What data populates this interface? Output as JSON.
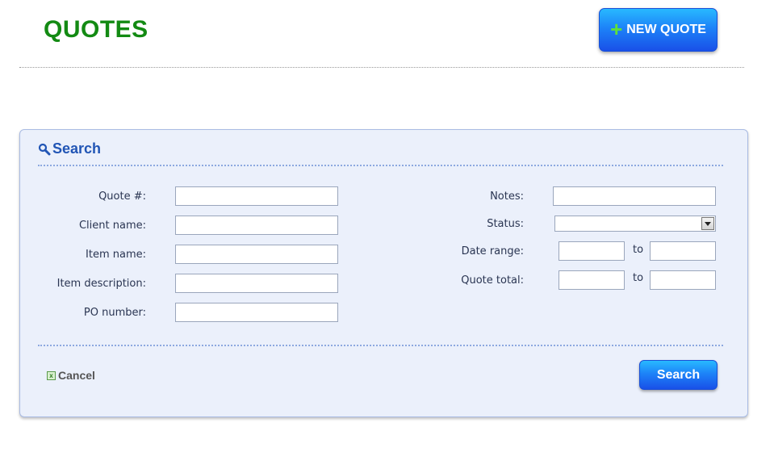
{
  "header": {
    "title": "QUOTES",
    "new_button_label": "NEW QUOTE"
  },
  "search_panel": {
    "title": "Search",
    "left_fields": [
      {
        "label": "Quote #:",
        "value": ""
      },
      {
        "label": "Client name:",
        "value": ""
      },
      {
        "label": "Item name:",
        "value": ""
      },
      {
        "label": "Item description:",
        "value": ""
      },
      {
        "label": "PO number:",
        "value": ""
      }
    ],
    "notes": {
      "label": "Notes:",
      "value": ""
    },
    "status": {
      "label": "Status:",
      "selected": ""
    },
    "date_range": {
      "label": "Date range:",
      "to_label": "to",
      "from_value": "",
      "to_value": ""
    },
    "quote_total": {
      "label": "Quote total:",
      "to_label": "to",
      "from_value": "",
      "to_value": ""
    },
    "cancel_label": "Cancel",
    "search_button_label": "Search"
  },
  "colors": {
    "title_green": "#138a13",
    "button_blue": "#1d83f8",
    "panel_bg": "#ebf0fb",
    "panel_title_blue": "#2155b5"
  }
}
